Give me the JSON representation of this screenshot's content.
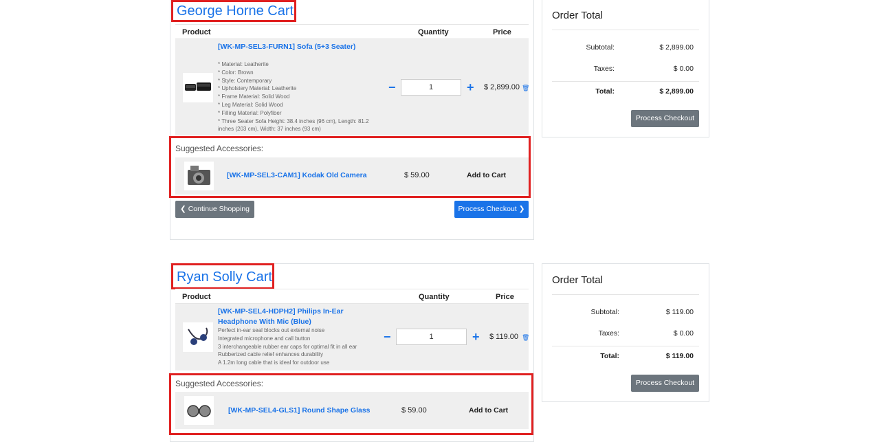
{
  "carts": [
    {
      "title": "George Horne Cart",
      "headers": {
        "product": "Product",
        "quantity": "Quantity",
        "price": "Price"
      },
      "product": {
        "name": "[WK-MP-SEL3-FURN1] Sofa (5+3 Seater)",
        "description": [
          "* Material: Leatherite",
          "* Color: Brown",
          "* Style: Contemporary",
          "* Upholstery Material: Leatherite",
          "* Frame Material: Solid Wood",
          "* Leg Material: Solid Wood",
          "* Filling Material: Polyfiber",
          "* Three Seater Sofa Height: 38.4 inches (96 cm), Length: 81.2",
          "inches (203 cm), Width: 37 inches (93 cm)"
        ],
        "minus": "−",
        "plus": "+",
        "quantity": "1",
        "price": "$ 2,899.00",
        "trash_icon": "🗑"
      },
      "suggested": {
        "title": "Suggested Accessories:",
        "name": "[WK-MP-SEL3-CAM1] Kodak Old Camera",
        "price": "$ 59.00",
        "add": "Add to Cart"
      },
      "continue": "Continue Shopping",
      "checkout": "Process Checkout",
      "order_total": {
        "title": "Order Total",
        "subtotal_label": "Subtotal:",
        "subtotal": "$ 2,899.00",
        "taxes_label": "Taxes:",
        "taxes": "$ 0.00",
        "total_label": "Total:",
        "total": "$ 2,899.00",
        "button": "Process Checkout"
      }
    },
    {
      "title": "Ryan Solly Cart",
      "headers": {
        "product": "Product",
        "quantity": "Quantity",
        "price": "Price"
      },
      "product": {
        "name": "[WK-MP-SEL4-HDPH2] Philips In-Ear Headphone With Mic (Blue)",
        "description": [
          "Perfect in-ear seal blocks out external noise",
          "Integrated microphone and call button",
          "3 interchangeable rubber ear caps for optimal fit in all ear",
          "Rubberized cable relief enhances durability",
          "A 1.2m long cable that is ideal for outdoor use"
        ],
        "minus": "−",
        "plus": "+",
        "quantity": "1",
        "price": "$ 119.00",
        "trash_icon": "🗑"
      },
      "suggested": {
        "title": "Suggested Accessories:",
        "name": "[WK-MP-SEL4-GLS1] Round Shape Glass",
        "price": "$ 59.00",
        "add": "Add to Cart"
      },
      "order_total": {
        "title": "Order Total",
        "subtotal_label": "Subtotal:",
        "subtotal": "$ 119.00",
        "taxes_label": "Taxes:",
        "taxes": "$ 0.00",
        "total_label": "Total:",
        "total": "$ 119.00",
        "button": "Process Checkout"
      }
    }
  ],
  "colors": {
    "link": "#1a73e8",
    "highlight": "#e02020",
    "button_gray": "#6c757d"
  }
}
